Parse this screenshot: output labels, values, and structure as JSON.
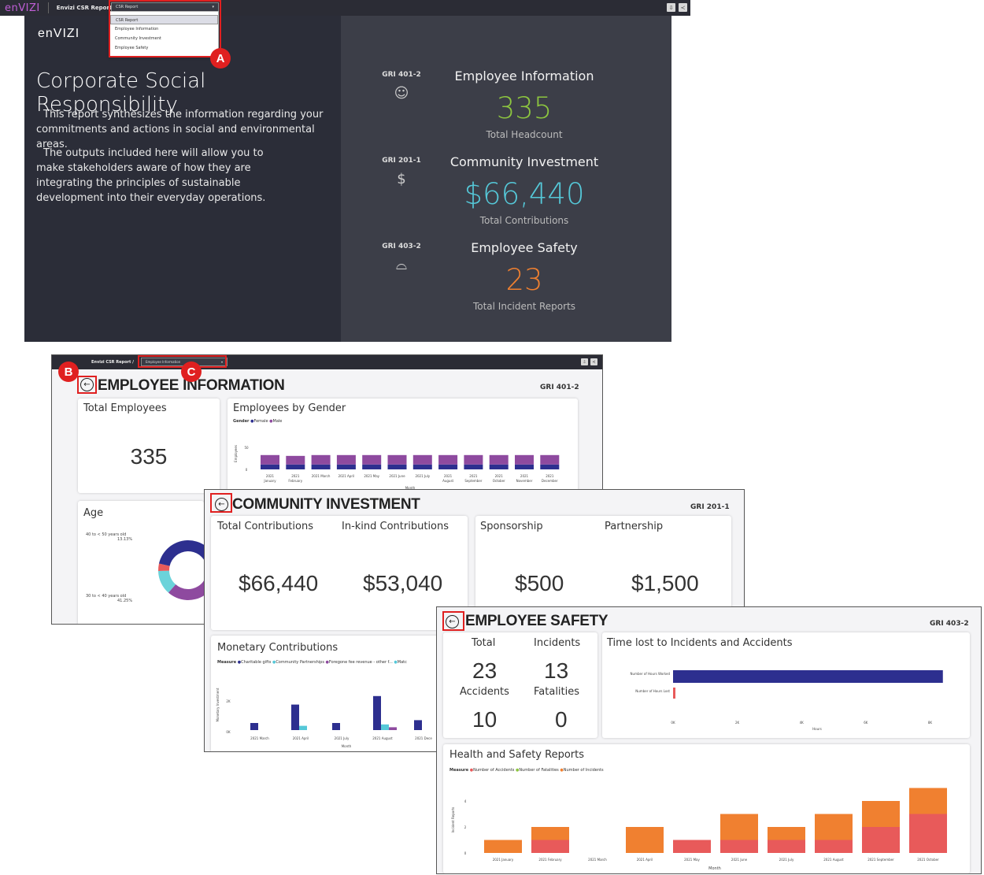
{
  "top": {
    "logo": "enVIZI",
    "breadcrumb": "Envizi CSR Report  /",
    "dropdown": "CSR Report"
  },
  "menu": [
    "CSR Report",
    "Employee Information",
    "Community Investment",
    "Employee Safety"
  ],
  "badges": {
    "a": "A",
    "b": "B",
    "c": "C"
  },
  "hero": {
    "logo": "enVIZI",
    "title": "Corporate Social Responsibility",
    "p1": "This report synthesizes the information regarding your commitments and actions in social and environmental areas.",
    "p2": "The outputs included here will allow you to make stakeholders aware of how they are integrating the principles of sustainable development into their everyday operations.",
    "kpis": [
      {
        "gri": "GRI 401-2",
        "icon": "people-icon",
        "title": "Employee Information",
        "value": "335",
        "sub": "Total Headcount",
        "color": "#8dc63f"
      },
      {
        "gri": "GRI 201-1",
        "icon": "money-icon",
        "title": "Community Investment",
        "value": "$66,440",
        "sub": "Total Contributions",
        "color": "#55c8d8"
      },
      {
        "gri": "GRI 403-2",
        "icon": "hardhat-icon",
        "title": "Employee Safety",
        "value": "23",
        "sub": "Total Incident Reports",
        "color": "#f08030"
      }
    ]
  },
  "emp": {
    "breadcrumb": "Envizi CSR Report  /",
    "dropdown": "Employee Information",
    "title": "EMPLOYEE INFORMATION",
    "gri": "GRI 401-2",
    "total_label": "Total Employees",
    "total": "335",
    "gender_title": "Employees by Gender",
    "legend_title": "Gender",
    "legend": [
      "Female",
      "Male"
    ],
    "ylabel": "Employees",
    "yticks": [
      "50",
      "0"
    ],
    "xlabel": "Month",
    "age_title": "Age",
    "age_lbl1": "40 to < 50 years old",
    "age_pct1": "13.13%",
    "age_lbl2": "30 to < 40 years old",
    "age_pct2": "41.25%"
  },
  "ci": {
    "title": "COMMUNITY INVESTMENT",
    "gri": "GRI 201-1",
    "kpis": [
      {
        "label": "Total Contributions",
        "value": "$66,440"
      },
      {
        "label": "In-kind Contributions",
        "value": "$53,040"
      },
      {
        "label": "Sponsorship",
        "value": "$500"
      },
      {
        "label": "Partnership",
        "value": "$1,500"
      }
    ],
    "mc_title": "Monetary Contributions",
    "legend_title": "Measure",
    "legend": [
      "Charitable gifts",
      "Community Partnerships",
      "Foregone fee revenue - other f...",
      "Matc"
    ],
    "ylabel": "Monetary Investment",
    "yticks": [
      "2K",
      "0K"
    ],
    "xlabel": "Month"
  },
  "es": {
    "title": "EMPLOYEE SAFETY",
    "gri": "GRI 403-2",
    "hdr_total": "Total",
    "hdr_inc": "Incidents",
    "n1": "23",
    "n2": "13",
    "l1": "Accidents",
    "l2": "Fatalities",
    "n3": "10",
    "n4": "0",
    "tl_title": "Time lost to Incidents and Accidents",
    "tl_rows": [
      "Number of Hours Worked",
      "Number of Hours Lost"
    ],
    "tl_xticks": [
      "0K",
      "2K",
      "4K",
      "6K",
      "8K"
    ],
    "tl_xlabel": "Hours",
    "hs_title": "Health and Safety Reports",
    "legend_title": "Measure",
    "legend": [
      "Number of Accidents",
      "Number of Fatalities",
      "Number of Incidents"
    ],
    "ylabel": "Incident Reports",
    "yticks": [
      "4",
      "2",
      "0"
    ],
    "xlabel": "Month"
  },
  "chart_data": [
    {
      "type": "bar",
      "title": "Employees by Gender",
      "xlabel": "Month",
      "ylabel": "Employees",
      "categories": [
        "2021 January",
        "2021 February",
        "2021 March",
        "2021 April",
        "2021 May",
        "2021 June",
        "2021 July",
        "2021 August",
        "2021 September",
        "2021 October",
        "2021 November",
        "2021 December"
      ],
      "series": [
        {
          "name": "Female",
          "values": [
            12,
            12,
            12,
            12,
            12,
            12,
            12,
            12,
            12,
            12,
            12,
            12
          ]
        },
        {
          "name": "Male",
          "values": [
            23,
            21,
            23,
            23,
            23,
            23,
            23,
            23,
            23,
            23,
            23,
            23
          ]
        }
      ],
      "stacked": true
    },
    {
      "type": "pie",
      "title": "Age",
      "categories": [
        "40 to < 50 years old",
        "30 to < 40 years old"
      ],
      "values": [
        13.13,
        41.25
      ]
    },
    {
      "type": "bar",
      "title": "Monetary Contributions",
      "xlabel": "Month",
      "ylabel": "Monetary Investment",
      "categories": [
        "2021 March",
        "2021 April",
        "2021 July",
        "2021 August",
        "2021 Dece"
      ],
      "series": [
        {
          "name": "Charitable gifts",
          "values": [
            0.5,
            1.8,
            0.5,
            2.4,
            0.7
          ]
        },
        {
          "name": "Community Partnerships",
          "values": [
            0,
            0.3,
            0,
            0.4,
            0
          ]
        },
        {
          "name": "Foregone fee revenue - other f...",
          "values": [
            0,
            0,
            0,
            0.2,
            0
          ]
        }
      ]
    },
    {
      "type": "bar",
      "title": "Time lost to Incidents and Accidents",
      "xlabel": "Hours",
      "categories": [
        "Number of Hours Worked",
        "Number of Hours Lost"
      ],
      "values": [
        8400,
        40
      ]
    },
    {
      "type": "bar",
      "title": "Health and Safety Reports",
      "xlabel": "Month",
      "ylabel": "Incident Reports",
      "stacked": true,
      "categories": [
        "2021 January",
        "2021 February",
        "2021 March",
        "2021 April",
        "2021 May",
        "2021 June",
        "2021 July",
        "2021 August",
        "2021 September",
        "2021 October"
      ],
      "series": [
        {
          "name": "Number of Accidents",
          "values": [
            0,
            1,
            0,
            0,
            1,
            1,
            1,
            1,
            2,
            3
          ]
        },
        {
          "name": "Number of Incidents",
          "values": [
            1,
            1,
            0,
            2,
            0,
            2,
            1,
            2,
            2,
            2
          ]
        }
      ]
    }
  ]
}
